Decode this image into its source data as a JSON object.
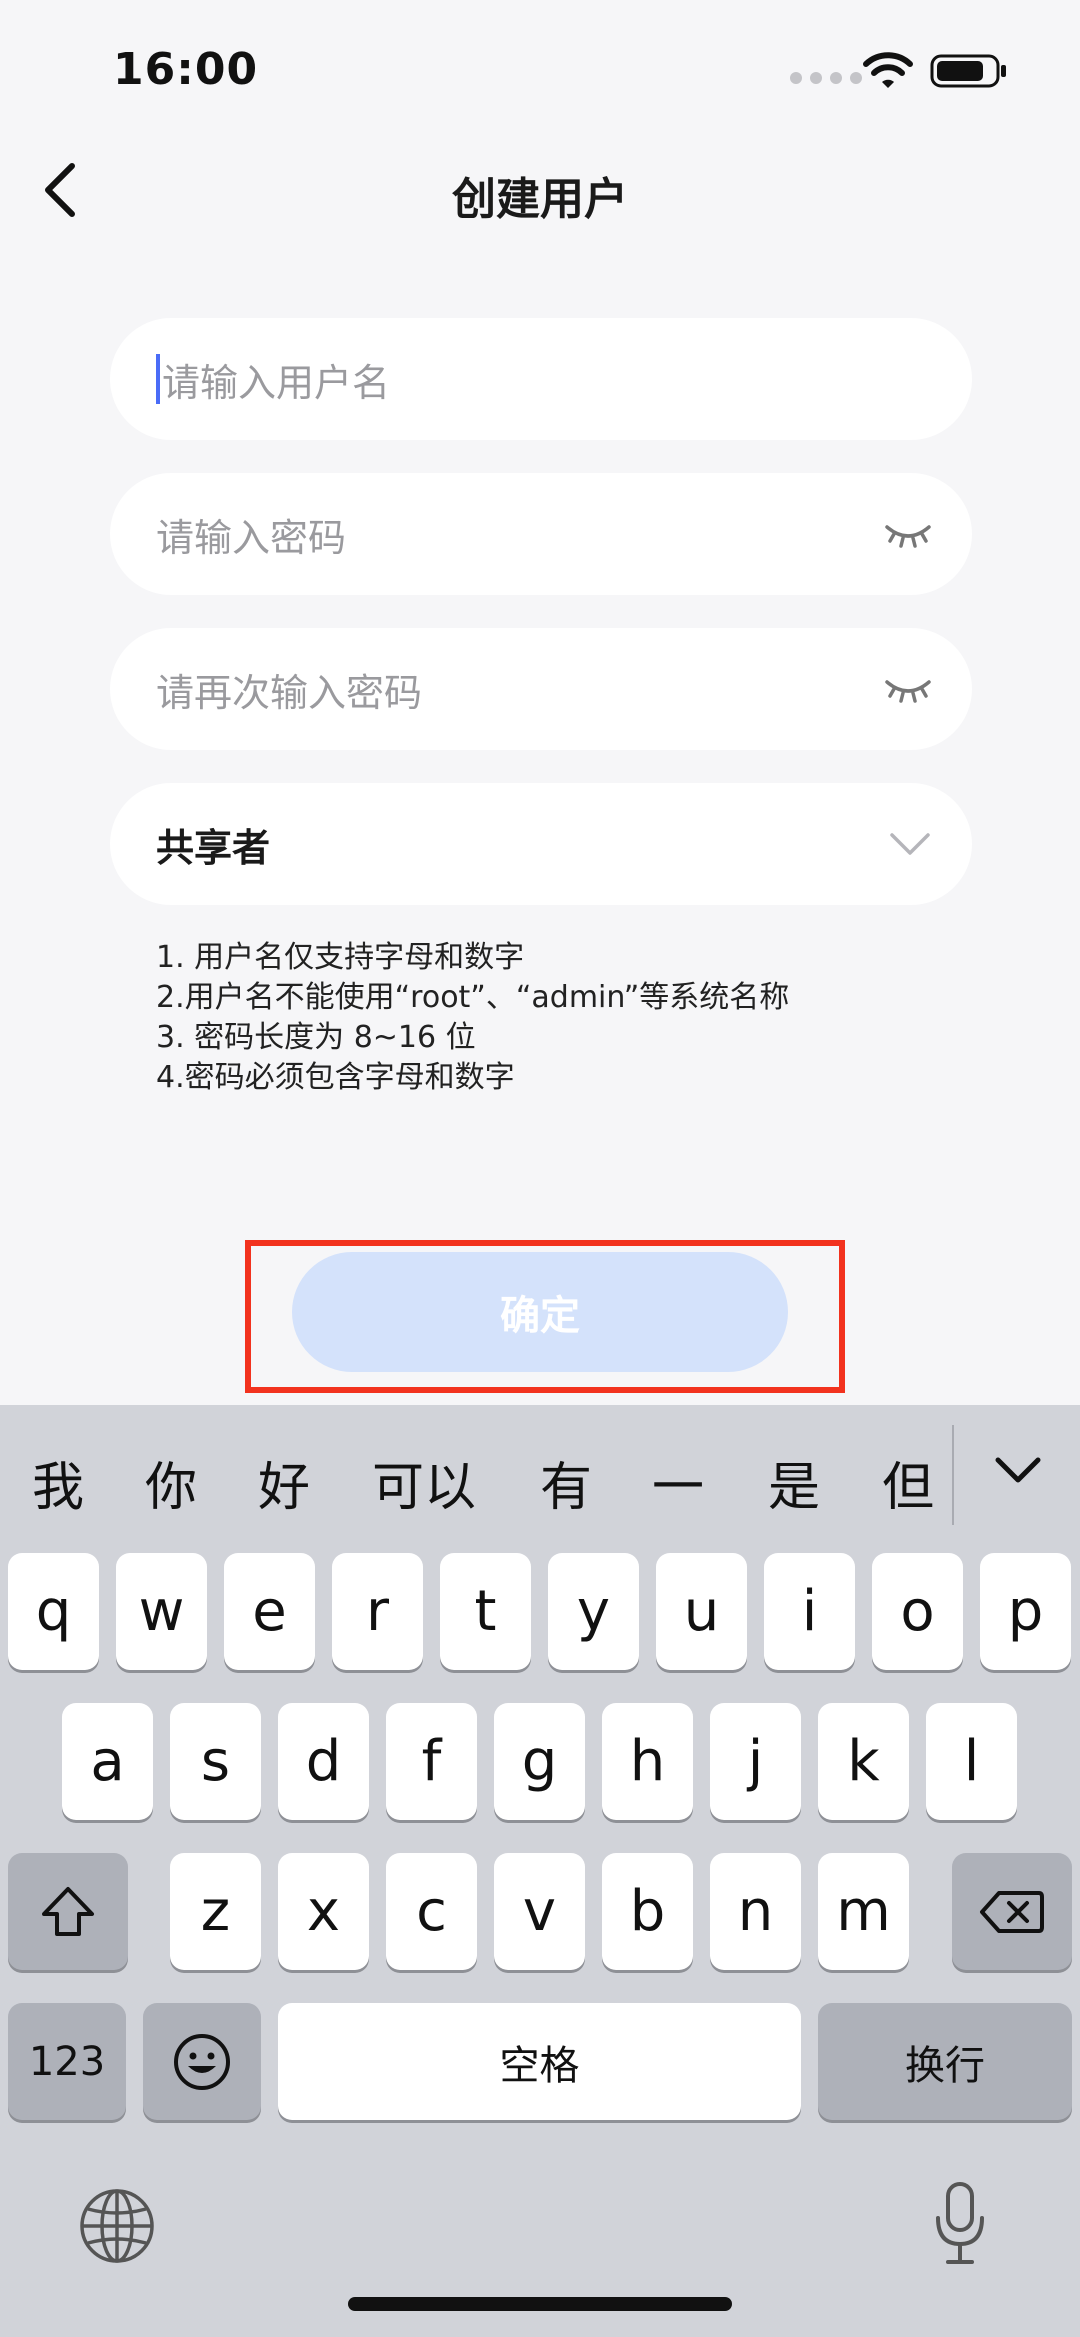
{
  "status_bar": {
    "time": "16:00"
  },
  "nav": {
    "title": "创建用户"
  },
  "form": {
    "username_placeholder": "请输入用户名",
    "password_placeholder": "请输入密码",
    "confirm_password_placeholder": "请再次输入密码",
    "role_value": "共享者"
  },
  "tips": [
    "1. 用户名仅支持字母和数字",
    "2.用户名不能使用“root”、“admin”等系统名称",
    "3. 密码长度为 8~16 位",
    "4.密码必须包含字母和数字"
  ],
  "confirm_button": {
    "label": "确定"
  },
  "keyboard": {
    "candidates": [
      "我",
      "你",
      "好",
      "可以",
      "有",
      "一",
      "是",
      "但"
    ],
    "row1": [
      "q",
      "w",
      "e",
      "r",
      "t",
      "y",
      "u",
      "i",
      "o",
      "p"
    ],
    "row2": [
      "a",
      "s",
      "d",
      "f",
      "g",
      "h",
      "j",
      "k",
      "l"
    ],
    "row3": [
      "z",
      "x",
      "c",
      "v",
      "b",
      "n",
      "m"
    ],
    "numbers_label": "123",
    "space_label": "空格",
    "return_label": "换行"
  },
  "colors": {
    "accent": "#4a6cf7",
    "button_disabled": "#d4e2fb",
    "highlight": "#f2321e"
  }
}
